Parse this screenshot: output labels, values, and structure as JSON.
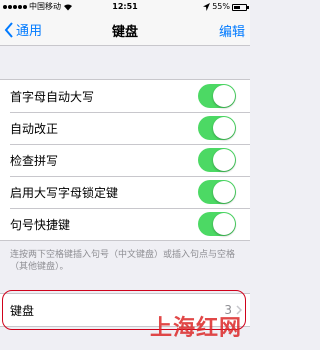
{
  "status_bar": {
    "carrier": "中国移动",
    "time": "12:51",
    "battery_percent": "55%",
    "battery_level": 0.55
  },
  "nav": {
    "back_label": "通用",
    "title": "键盘",
    "edit_label": "编辑"
  },
  "settings": [
    {
      "label": "首字母自动大写",
      "on": true
    },
    {
      "label": "自动改正",
      "on": true
    },
    {
      "label": "检查拼写",
      "on": true
    },
    {
      "label": "启用大写字母锁定键",
      "on": true
    },
    {
      "label": "句号快捷键",
      "on": true
    }
  ],
  "footer": "连按两下空格键插入句号（中文键盘）或插入句点与空格（其他键盘）。",
  "keyboards": {
    "label": "键盘",
    "value": "3"
  },
  "watermark": "上海红网",
  "colors": {
    "accent": "#007aff",
    "toggle_on": "#4cd964",
    "highlight": "#d0021b"
  }
}
